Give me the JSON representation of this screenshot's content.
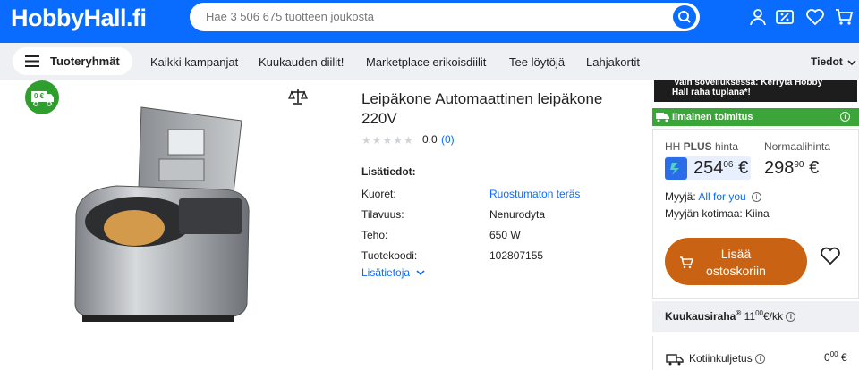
{
  "header": {
    "logo": "HobbyHall.fi",
    "search_placeholder": "Hae 3 506 675 tuotteen joukosta"
  },
  "nav": {
    "categories_label": "Tuoteryhmät",
    "items": [
      "Kaikki kampanjat",
      "Kuukauden diilit!",
      "Marketplace erikoisdiilit",
      "Tee löytöjä",
      "Lahjakortit"
    ],
    "info_label": "Tiedot"
  },
  "badge": {
    "text": "0 €"
  },
  "product": {
    "title": "Leipäkone Automaattinen leipäkone 220V",
    "stars": "★★★★★",
    "rating": "0.0",
    "rating_count": "(0)",
    "info_heading": "Lisätiedot:",
    "specs": [
      {
        "key": "Kuoret:",
        "value": "Ruostumaton teräs"
      },
      {
        "key": "Tilavuus:",
        "value": "Nenurodyta"
      },
      {
        "key": "Teho:",
        "value": "650 W"
      },
      {
        "key": "Tuotekoodi:",
        "value": "102807155"
      }
    ],
    "more_label": "Lisätietoja"
  },
  "sidebar": {
    "promo_line1": "Vain sovelluksessa: Kerryta Hobby",
    "promo_line2": "Hall raha tuplana*!",
    "shipping": "Ilmainen toimitus",
    "hh_label_prefix": "HH ",
    "hh_label_bold": "PLUS",
    "hh_label_suffix": " hinta",
    "normal_label": "Normaalihinta",
    "hh_price_int": "254",
    "hh_price_dec": "06",
    "normal_price_int": "298",
    "normal_price_dec": "90",
    "currency": "€",
    "seller_label": "Myyjä:",
    "seller_name": "All for you",
    "seller_country": "Myyjän kotimaa: Kiina",
    "cart_line1": "Lisää",
    "cart_line2": "ostoskoriin",
    "monthly_label": "Kuukausiraha",
    "monthly_reg": "®",
    "monthly_int": "11",
    "monthly_dec": "00",
    "monthly_unit": "€/kk",
    "delivery_label": "Kotiinkuljetus",
    "delivery_int": "0",
    "delivery_dec": "00",
    "delivery_cur": "€"
  },
  "colors": {
    "brand": "#0a6cff",
    "cart": "#c96212",
    "shipping": "#3ca53a"
  }
}
